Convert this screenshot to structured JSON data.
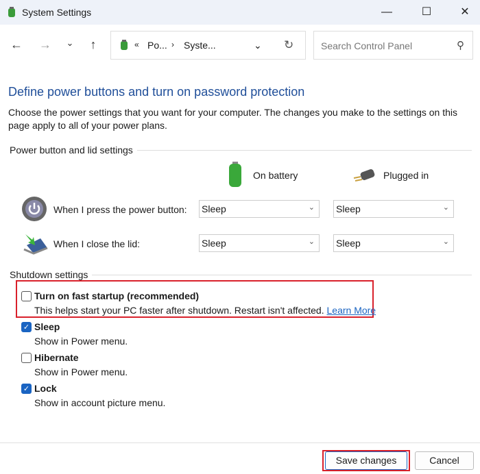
{
  "window": {
    "title": "System Settings"
  },
  "nav": {
    "breadcrumb_overflow": "«",
    "crumbs": [
      "Po...",
      "Syste..."
    ],
    "search_placeholder": "Search Control Panel"
  },
  "page": {
    "heading": "Define power buttons and turn on password protection",
    "description": "Choose the power settings that you want for your computer. The changes you make to the settings on this page apply to all of your power plans."
  },
  "power": {
    "section": "Power button and lid settings",
    "col_battery": "On battery",
    "col_plugged": "Plugged in",
    "rows": [
      {
        "label": "When I press the power button:",
        "battery": "Sleep",
        "plugged": "Sleep"
      },
      {
        "label": "When I close the lid:",
        "battery": "Sleep",
        "plugged": "Sleep"
      }
    ]
  },
  "shutdown": {
    "section": "Shutdown settings",
    "items": [
      {
        "label": "Turn on fast startup (recommended)",
        "desc": "This helps start your PC faster after shutdown. Restart isn't affected.",
        "link": "Learn More",
        "checked": false
      },
      {
        "label": "Sleep",
        "desc": "Show in Power menu.",
        "checked": true
      },
      {
        "label": "Hibernate",
        "desc": "Show in Power menu.",
        "checked": false
      },
      {
        "label": "Lock",
        "desc": "Show in account picture menu.",
        "checked": true
      }
    ]
  },
  "footer": {
    "save": "Save changes",
    "cancel": "Cancel"
  },
  "colors": {
    "accent": "#1a64c2",
    "heading": "#1f4e99",
    "highlight": "#d9202a"
  }
}
